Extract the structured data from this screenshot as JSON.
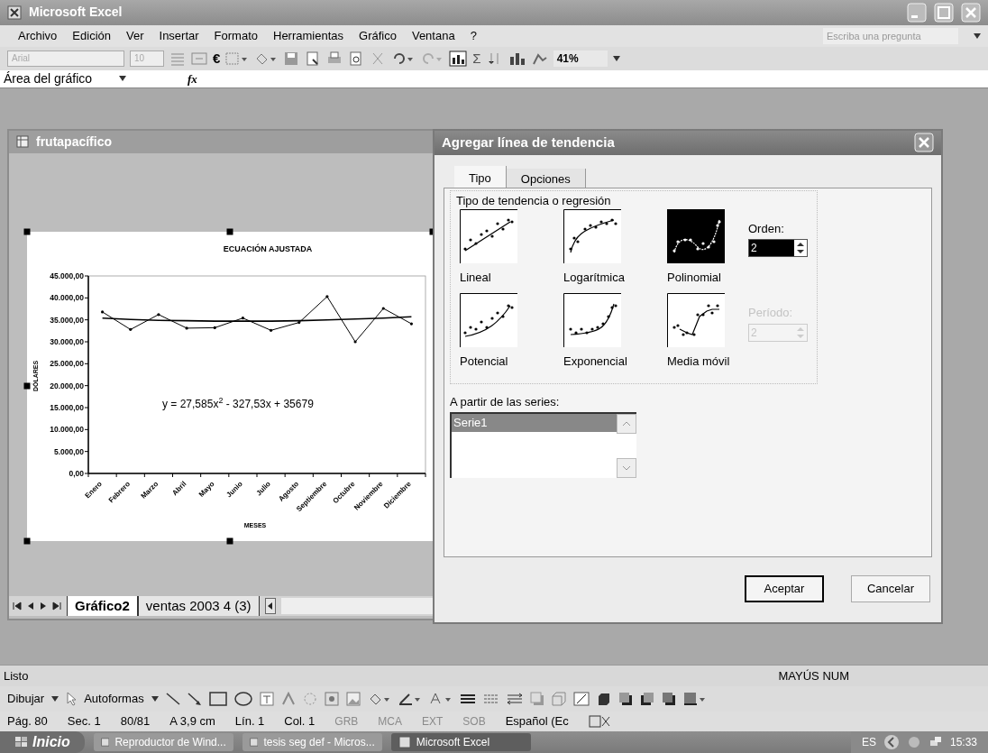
{
  "window": {
    "title": "Microsoft Excel"
  },
  "menu": [
    "Archivo",
    "Edición",
    "Ver",
    "Insertar",
    "Formato",
    "Herramientas",
    "Gráfico",
    "Ventana",
    "?"
  ],
  "question_box": {
    "placeholder": "Escriba una pregunta"
  },
  "toolbar": {
    "font": "Arial",
    "size": "10",
    "euro": "€",
    "sigma": "Σ",
    "zoom": "41%"
  },
  "formula_bar": {
    "name_box": "Área del gráfico",
    "fx": "fx"
  },
  "workbook": {
    "title": "frutapacífico",
    "chart_data": {
      "type": "line",
      "title": "ECUACIÓN AJUSTADA",
      "xlabel": "MESES",
      "ylabel": "DÓLARES",
      "categories": [
        "Enero",
        "Febrero",
        "Marzo",
        "Abril",
        "Mayo",
        "Junio",
        "Julio",
        "Agosto",
        "Septiembre",
        "Octubre",
        "Noviembre",
        "Diciembre"
      ],
      "series": [
        {
          "color": "#000000",
          "values": [
            36800,
            32800,
            36200,
            33100,
            33200,
            35400,
            32600,
            34400,
            40300,
            30000,
            37600,
            34100
          ]
        },
        {
          "color": "#000000",
          "values": [
            35400,
            35100,
            34900,
            34800,
            34700,
            34700,
            34700,
            34800,
            35000,
            35200,
            35400,
            35700
          ]
        }
      ],
      "ylim": [
        0,
        45000
      ],
      "yticks": [
        {
          "value": 0,
          "label": "0,00"
        },
        {
          "value": 5000,
          "label": "5.000,00"
        },
        {
          "value": 10000,
          "label": "10.000,00"
        },
        {
          "value": 15000,
          "label": "15.000,00"
        },
        {
          "value": 20000,
          "label": "20.000,00"
        },
        {
          "value": 25000,
          "label": "25.000,00"
        },
        {
          "value": 30000,
          "label": "30.000,00"
        },
        {
          "value": 35000,
          "label": "35.000,00"
        },
        {
          "value": 40000,
          "label": "40.000,00"
        },
        {
          "value": 45000,
          "label": "45.000,00"
        }
      ],
      "annotations": [
        {
          "text": "y = 27,585x$^{2}$ - 327,53x + 35679"
        }
      ]
    },
    "sheet_tabs": [
      {
        "label": "Gráfico2",
        "selected": true
      },
      {
        "label": "ventas 2003 4 (3)",
        "selected": false
      }
    ]
  },
  "dialog": {
    "title": "Agregar línea de tendencia",
    "tabs": [
      {
        "label": "Tipo",
        "selected": true
      },
      {
        "label": "Opciones",
        "selected": false
      }
    ],
    "group_label": "Tipo de tendencia o regresión",
    "types": [
      {
        "kind": "linear",
        "label": "Lineal",
        "selected": false
      },
      {
        "kind": "log",
        "label": "Logarítmica",
        "selected": false
      },
      {
        "kind": "poly",
        "label": "Polinomial",
        "selected": true
      },
      {
        "kind": "power",
        "label": "Potencial",
        "selected": false
      },
      {
        "kind": "exp",
        "label": "Exponencial",
        "selected": false
      },
      {
        "kind": "moving",
        "label": "Media móvil",
        "selected": false
      }
    ],
    "order": {
      "label": "Orden:",
      "value": "2",
      "disabled": false
    },
    "period": {
      "label": "Período:",
      "value": "2",
      "disabled": true
    },
    "series_label": "A partir de las series:",
    "series": [
      {
        "label": "Serie1",
        "selected": true
      }
    ],
    "buttons": [
      {
        "label": "Aceptar",
        "default": true
      },
      {
        "label": "Cancelar",
        "default": false
      }
    ]
  },
  "status_bar": {
    "left": "Listo",
    "right": "MAYÚS NUM"
  },
  "drawing_toolbar": {
    "draw": "Dibujar",
    "autoshapes": "Autoformas"
  },
  "word_status": [
    {
      "text": "Pág. 80",
      "disabled": false
    },
    {
      "text": "Sec. 1",
      "disabled": false
    },
    {
      "text": "80/81",
      "disabled": false
    },
    {
      "text": "A 3,9 cm",
      "disabled": false
    },
    {
      "text": "Lín. 1",
      "disabled": false
    },
    {
      "text": "Col. 1",
      "disabled": false
    },
    {
      "text": "GRB",
      "disabled": true
    },
    {
      "text": "MCA",
      "disabled": true
    },
    {
      "text": "EXT",
      "disabled": true
    },
    {
      "text": "SOB",
      "disabled": true
    },
    {
      "text": "Español (Ec",
      "disabled": false
    }
  ],
  "taskbar": {
    "start": "Inicio",
    "tasks": [
      {
        "label": "Reproductor de Wind...",
        "selected": false
      },
      {
        "label": "tesis seg def - Micros...",
        "selected": false
      },
      {
        "label": "Microsoft Excel",
        "selected": true
      }
    ],
    "language": "ES",
    "clock": "15:33"
  }
}
